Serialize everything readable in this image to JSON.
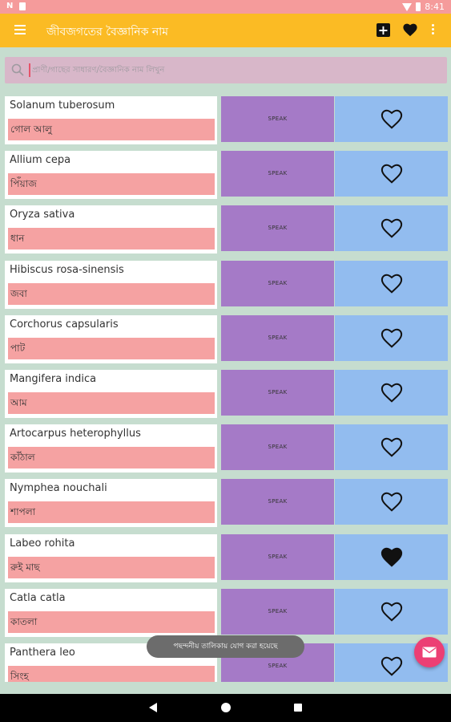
{
  "status_bar": {
    "left_glyph": "N",
    "time": "8:41"
  },
  "app_bar": {
    "title": "জীবজগতের বৈজ্ঞানিক নাম",
    "colors": {
      "background": "#fbbb24",
      "icons": "#ffffff"
    }
  },
  "search": {
    "placeholder": "প্রাণী/গাছের সাধারণ/বৈজ্ঞানিক নাম লিখুন",
    "value": ""
  },
  "speak_label": "SPEAK",
  "items": [
    {
      "scientific_name": "Solanum tuberosum",
      "common_name": "গোল আলু",
      "favorited": false
    },
    {
      "scientific_name": "Allium cepa",
      "common_name": "পিঁয়াজ",
      "favorited": false
    },
    {
      "scientific_name": "Oryza sativa",
      "common_name": "ধান",
      "favorited": false
    },
    {
      "scientific_name": "Hibiscus rosa-sinensis",
      "common_name": "জবা",
      "favorited": false
    },
    {
      "scientific_name": "Corchorus capsularis",
      "common_name": "পাট",
      "favorited": false
    },
    {
      "scientific_name": "Mangifera indica",
      "common_name": "আম",
      "favorited": false
    },
    {
      "scientific_name": "Artocarpus heterophyllus",
      "common_name": "কাঁঠাল",
      "favorited": false
    },
    {
      "scientific_name": "Nymphea nouchali",
      "common_name": "শাপলা",
      "favorited": false
    },
    {
      "scientific_name": "Labeo rohita",
      "common_name": "রুই মাছ",
      "favorited": true
    },
    {
      "scientific_name": "Catla catla",
      "common_name": "কাতলা",
      "favorited": false
    },
    {
      "scientific_name": "Panthera leo",
      "common_name": "সিংহ",
      "favorited": false
    }
  ],
  "toast": "পছন্দনীয় তালিকায় যোগ করা হয়েছে",
  "icons": [
    "menu-icon",
    "add-box-icon",
    "heart-icon",
    "more-vert-icon",
    "search-icon",
    "heart-outline-icon",
    "heart-filled-icon",
    "email-icon",
    "back-icon",
    "home-icon",
    "recents-icon"
  ]
}
